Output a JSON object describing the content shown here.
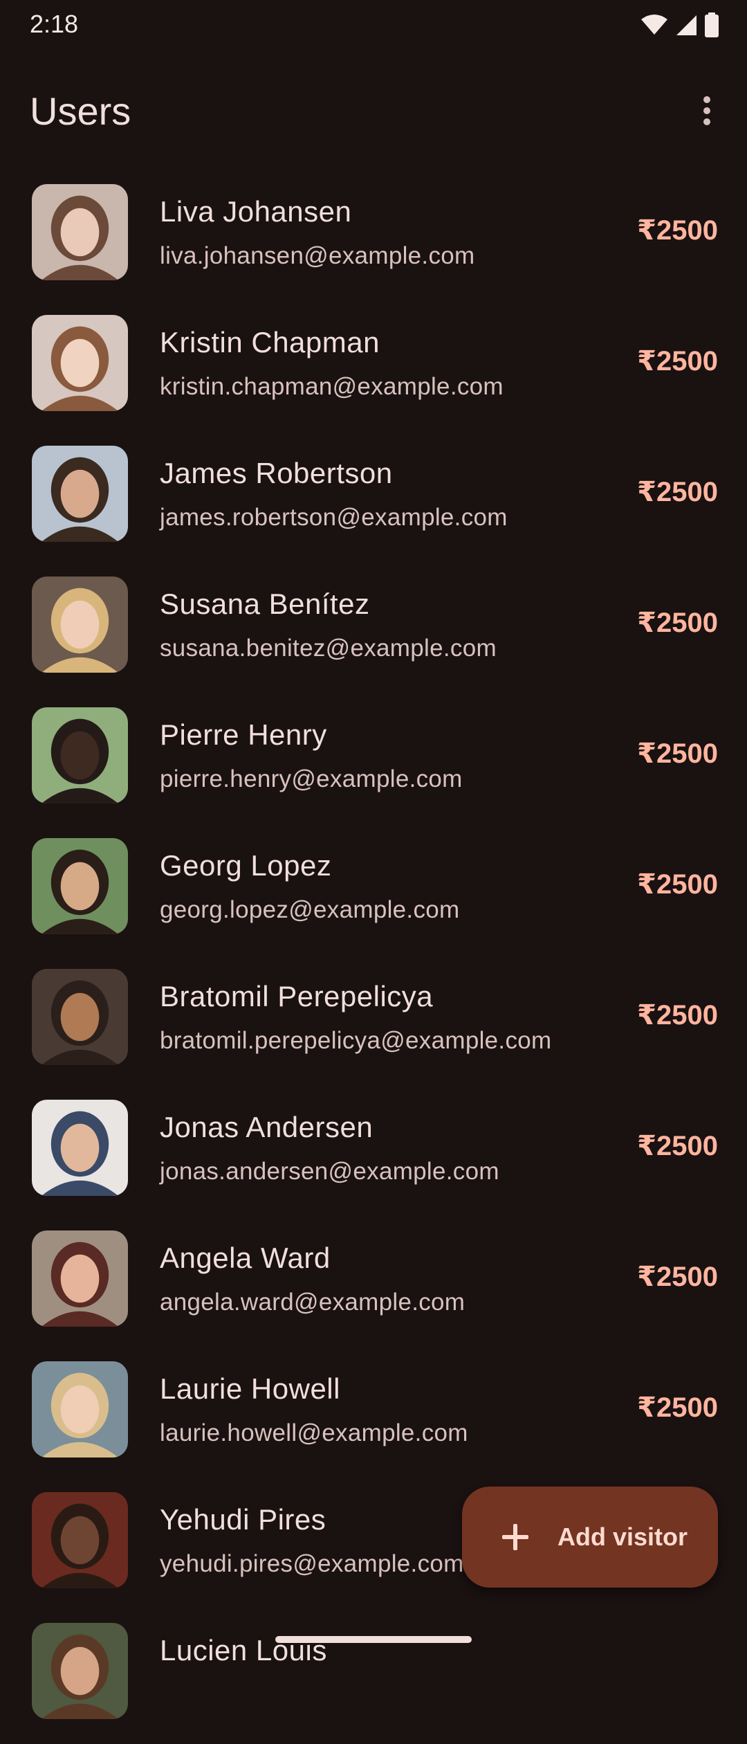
{
  "status_bar": {
    "time": "2:18",
    "icons": [
      "wifi-icon",
      "cellular-signal-icon",
      "battery-icon"
    ]
  },
  "app_bar": {
    "title": "Users",
    "more_icon": "more-vert-icon"
  },
  "colors": {
    "background": "#1a1111",
    "accent": "#ffb59f",
    "fab_background": "#733422",
    "fab_text": "#ffdbd0"
  },
  "users": [
    {
      "name": "Liva Johansen",
      "email": "liva.johansen@example.com",
      "amount": "₹2500"
    },
    {
      "name": "Kristin Chapman",
      "email": "kristin.chapman@example.com",
      "amount": "₹2500"
    },
    {
      "name": "James Robertson",
      "email": "james.robertson@example.com",
      "amount": "₹2500"
    },
    {
      "name": "Susana Benítez",
      "email": "susana.benitez@example.com",
      "amount": "₹2500"
    },
    {
      "name": "Pierre Henry",
      "email": "pierre.henry@example.com",
      "amount": "₹2500"
    },
    {
      "name": "Georg Lopez",
      "email": "georg.lopez@example.com",
      "amount": "₹2500"
    },
    {
      "name": "Bratomil Perepelicya",
      "email": "bratomil.perepelicya@example.com",
      "amount": "₹2500"
    },
    {
      "name": "Jonas Andersen",
      "email": "jonas.andersen@example.com",
      "amount": "₹2500"
    },
    {
      "name": "Angela Ward",
      "email": "angela.ward@example.com",
      "amount": "₹2500"
    },
    {
      "name": "Laurie Howell",
      "email": "laurie.howell@example.com",
      "amount": "₹2500"
    },
    {
      "name": "Yehudi Pires",
      "email": "yehudi.pires@example.com",
      "amount": ""
    },
    {
      "name": "Lucien Louis",
      "email": "",
      "amount": ""
    }
  ],
  "fab": {
    "label": "Add visitor",
    "icon": "add-icon"
  }
}
